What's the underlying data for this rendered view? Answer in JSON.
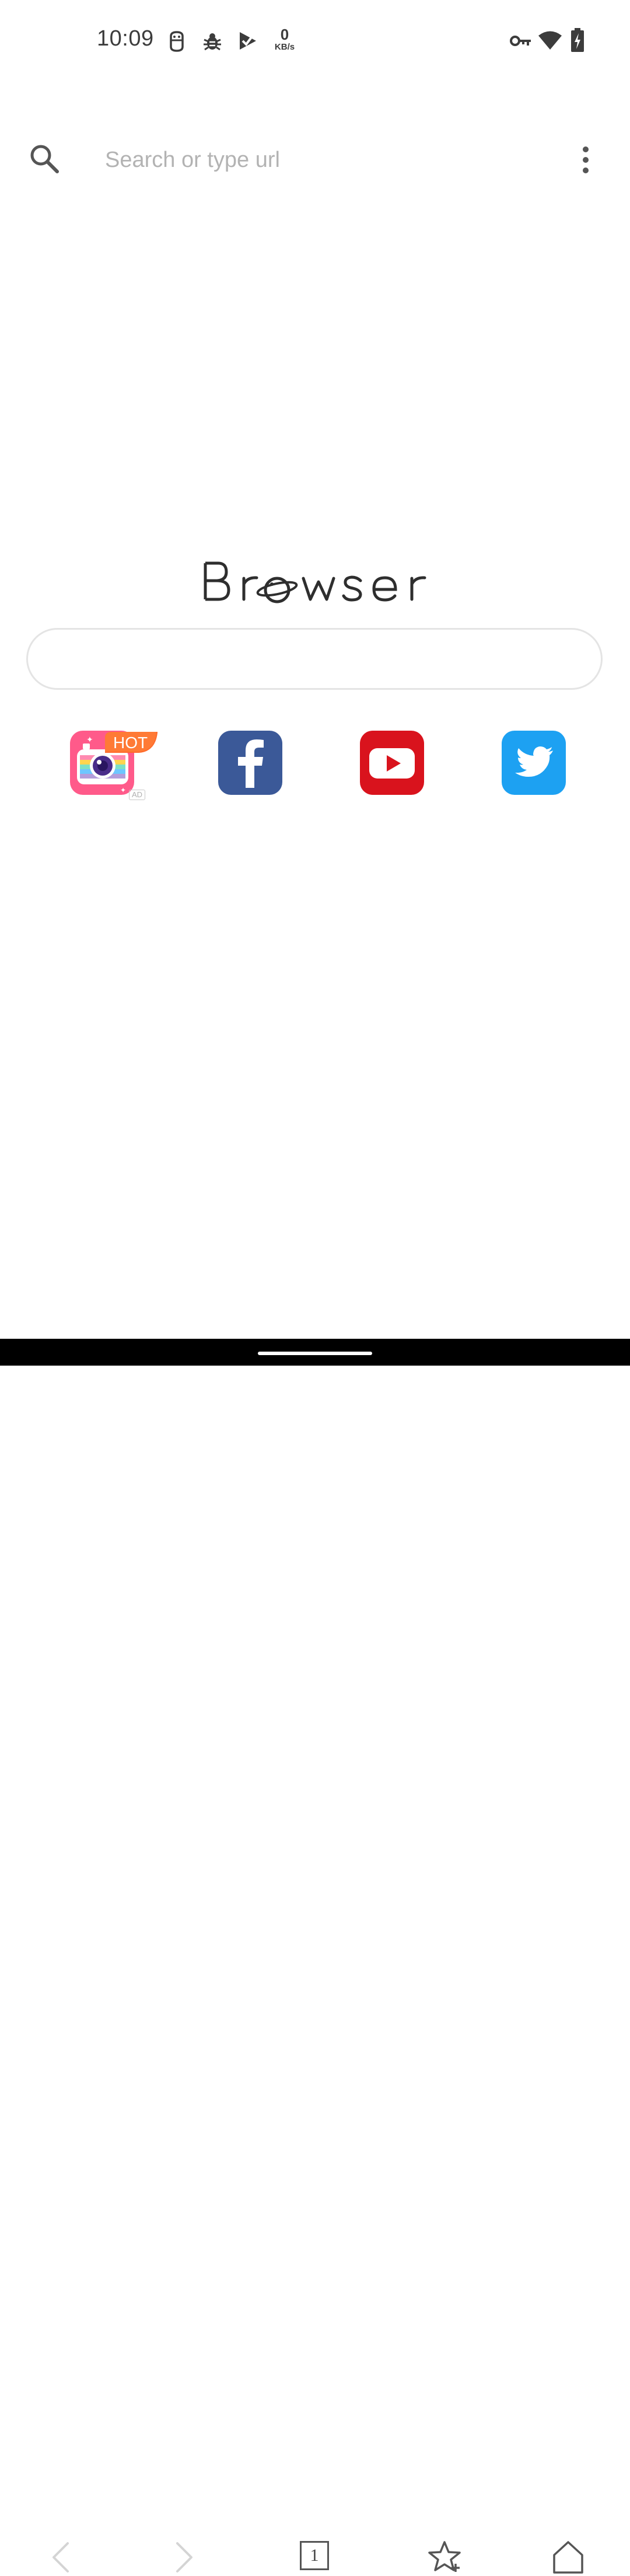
{
  "status_bar": {
    "time": "10:09",
    "net_speed_value": "0",
    "net_speed_unit": "KB/s",
    "left_icons": [
      "android-debug-icon",
      "bug-icon",
      "play-protect-icon"
    ],
    "right_icons": [
      "vpn-key-icon",
      "wifi-icon",
      "battery-charging-icon"
    ]
  },
  "address_bar": {
    "placeholder": "Search or type url",
    "value": "",
    "search_icon": "search-icon",
    "menu_icon": "more-vertical-icon"
  },
  "logo": {
    "text": "Browser"
  },
  "main_search": {
    "value": ""
  },
  "shortcuts": [
    {
      "name": "beauty-camera",
      "label": "",
      "badge": "HOT",
      "ad_label": "AD",
      "color": "#ff5a8a"
    },
    {
      "name": "facebook",
      "label": "",
      "color": "#3b5998"
    },
    {
      "name": "youtube",
      "label": "",
      "color": "#d9131d"
    },
    {
      "name": "twitter",
      "label": "",
      "color": "#1da1f2"
    }
  ],
  "bottom_nav": {
    "tab_count": "1",
    "items": [
      "back-icon",
      "forward-icon",
      "tabs-icon",
      "bookmark-add-icon",
      "home-icon"
    ]
  }
}
